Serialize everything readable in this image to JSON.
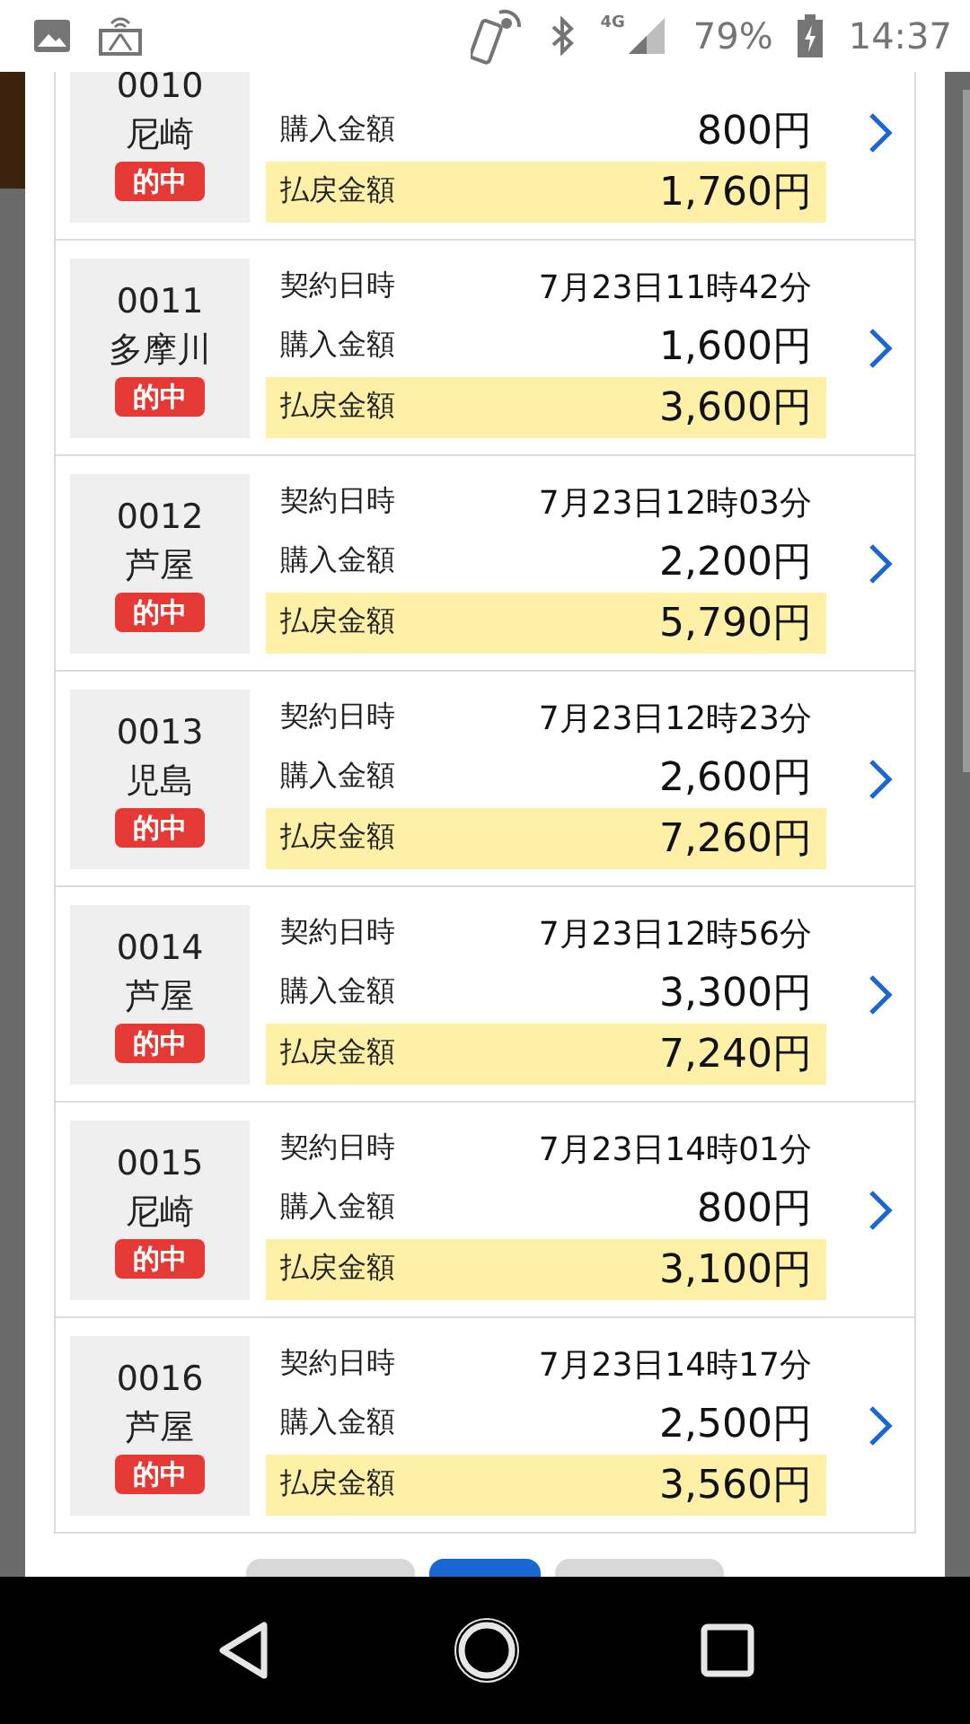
{
  "status_bar": {
    "network": "4G",
    "battery": "79%",
    "time": "14:37"
  },
  "tickets": [
    {
      "number": "0010",
      "venue": "尼崎",
      "result": "的中",
      "purchase_label": "購入金額",
      "purchase": "800円",
      "payout_label": "払戻金額",
      "payout": "1,760円"
    },
    {
      "number": "0011",
      "venue": "多摩川",
      "result": "的中",
      "contract_label": "契約日時",
      "contract": "7月23日11時42分",
      "purchase_label": "購入金額",
      "purchase": "1,600円",
      "payout_label": "払戻金額",
      "payout": "3,600円"
    },
    {
      "number": "0012",
      "venue": "芦屋",
      "result": "的中",
      "contract_label": "契約日時",
      "contract": "7月23日12時03分",
      "purchase_label": "購入金額",
      "purchase": "2,200円",
      "payout_label": "払戻金額",
      "payout": "5,790円"
    },
    {
      "number": "0013",
      "venue": "児島",
      "result": "的中",
      "contract_label": "契約日時",
      "contract": "7月23日12時23分",
      "purchase_label": "購入金額",
      "purchase": "2,600円",
      "payout_label": "払戻金額",
      "payout": "7,260円"
    },
    {
      "number": "0014",
      "venue": "芦屋",
      "result": "的中",
      "contract_label": "契約日時",
      "contract": "7月23日12時56分",
      "purchase_label": "購入金額",
      "purchase": "3,300円",
      "payout_label": "払戻金額",
      "payout": "7,240円"
    },
    {
      "number": "0015",
      "venue": "尼崎",
      "result": "的中",
      "contract_label": "契約日時",
      "contract": "7月23日14時01分",
      "purchase_label": "購入金額",
      "purchase": "800円",
      "payout_label": "払戻金額",
      "payout": "3,100円"
    },
    {
      "number": "0016",
      "venue": "芦屋",
      "result": "的中",
      "contract_label": "契約日時",
      "contract": "7月23日14時17分",
      "purchase_label": "購入金額",
      "purchase": "2,500円",
      "payout_label": "払戻金額",
      "payout": "3,560円"
    }
  ],
  "pager": [
    {
      "selected": false
    },
    {
      "selected": true
    },
    {
      "selected": false
    }
  ]
}
